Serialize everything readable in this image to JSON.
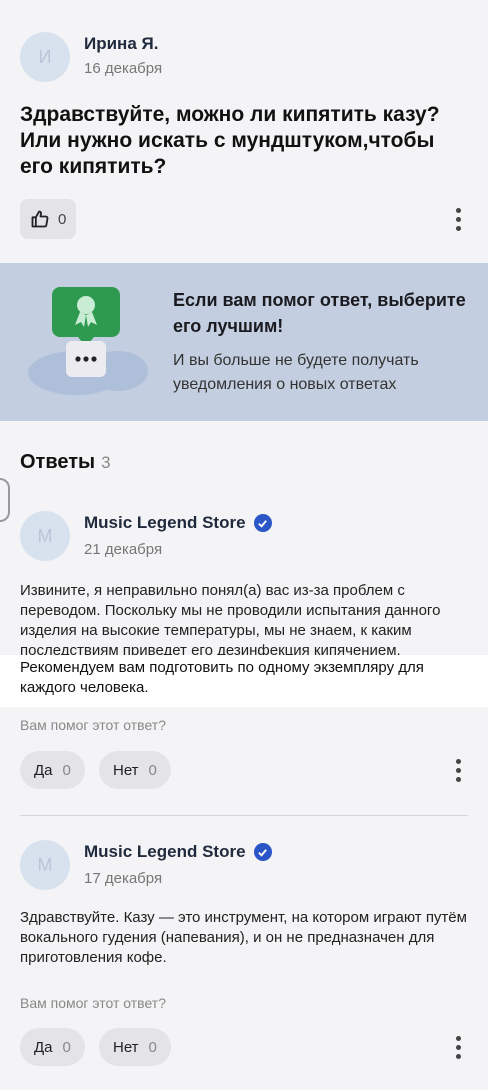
{
  "question": {
    "author_name": "Ирина Я.",
    "avatar_letter": "И",
    "date": "16 декабря",
    "text": "Здравствуйте, можно ли кипятить казу? Или нужно искать с мундштуком,чтобы его кипятить?",
    "likes": "0"
  },
  "banner": {
    "title": "Если вам помог ответ, выберите его лучшим!",
    "subtitle": "И вы больше не будете получать уведомления о новых ответах"
  },
  "answers_section": {
    "heading": "Ответы",
    "count": "3"
  },
  "answers": [
    {
      "author_name": "Music Legend Store",
      "avatar_letter": "M",
      "date": "21 декабря",
      "text": "Извините, я неправильно понял(а) вас из-за проблем с переводом. Поскольку мы не проводили испытания данного изделия на высокие температуры, мы не знаем, к каким последствиям приведет его дезинфекция кипячением.",
      "highlighted_text": "Рекомендуем вам подготовить по одному экземпляру для каждого человека.",
      "helpful_question": "Вам помог этот ответ?",
      "yes_label": "Да",
      "yes_count": "0",
      "no_label": "Нет",
      "no_count": "0"
    },
    {
      "author_name": "Music Legend Store",
      "avatar_letter": "M",
      "date": "17 декабря",
      "text": "Здравствуйте. Казу — это инструмент, на котором играют путём вокального гудения (напевания), и он не предназначен для приготовления кофе.",
      "helpful_question": "Вам помог этот ответ?",
      "yes_label": "Да",
      "yes_count": "0",
      "no_label": "Нет",
      "no_count": "0"
    }
  ],
  "colors": {
    "background": "#f4f4f6",
    "banner": "#c3cfe0",
    "verified": "#2a56c7",
    "badge_green": "#2e9a4f"
  }
}
